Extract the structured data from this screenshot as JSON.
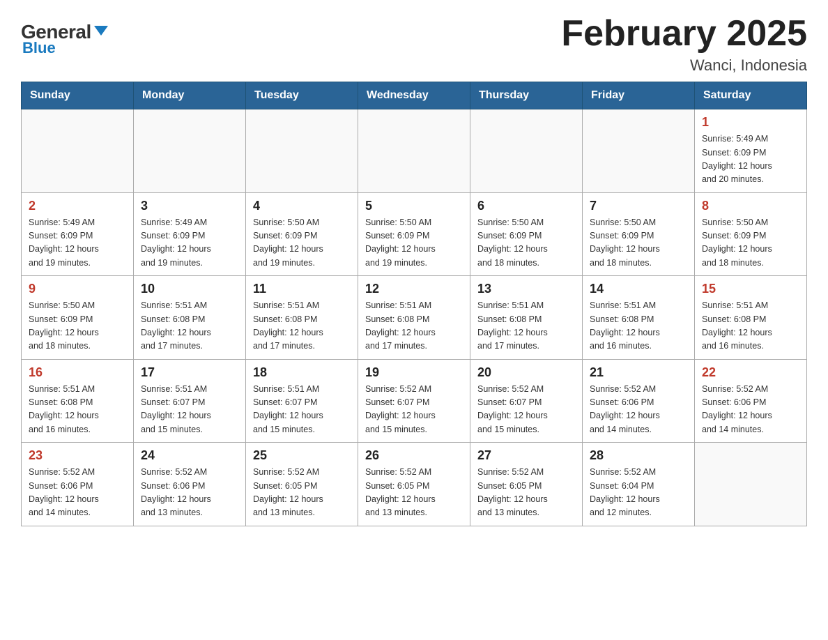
{
  "logo": {
    "general": "General",
    "blue": "Blue",
    "tagline": "GeneralBlue"
  },
  "header": {
    "title": "February 2025",
    "subtitle": "Wanci, Indonesia"
  },
  "days_of_week": [
    "Sunday",
    "Monday",
    "Tuesday",
    "Wednesday",
    "Thursday",
    "Friday",
    "Saturday"
  ],
  "weeks": [
    {
      "days": [
        {
          "number": "",
          "info": ""
        },
        {
          "number": "",
          "info": ""
        },
        {
          "number": "",
          "info": ""
        },
        {
          "number": "",
          "info": ""
        },
        {
          "number": "",
          "info": ""
        },
        {
          "number": "",
          "info": ""
        },
        {
          "number": "1",
          "info": "Sunrise: 5:49 AM\nSunset: 6:09 PM\nDaylight: 12 hours\nand 20 minutes."
        }
      ]
    },
    {
      "days": [
        {
          "number": "2",
          "info": "Sunrise: 5:49 AM\nSunset: 6:09 PM\nDaylight: 12 hours\nand 19 minutes."
        },
        {
          "number": "3",
          "info": "Sunrise: 5:49 AM\nSunset: 6:09 PM\nDaylight: 12 hours\nand 19 minutes."
        },
        {
          "number": "4",
          "info": "Sunrise: 5:50 AM\nSunset: 6:09 PM\nDaylight: 12 hours\nand 19 minutes."
        },
        {
          "number": "5",
          "info": "Sunrise: 5:50 AM\nSunset: 6:09 PM\nDaylight: 12 hours\nand 19 minutes."
        },
        {
          "number": "6",
          "info": "Sunrise: 5:50 AM\nSunset: 6:09 PM\nDaylight: 12 hours\nand 18 minutes."
        },
        {
          "number": "7",
          "info": "Sunrise: 5:50 AM\nSunset: 6:09 PM\nDaylight: 12 hours\nand 18 minutes."
        },
        {
          "number": "8",
          "info": "Sunrise: 5:50 AM\nSunset: 6:09 PM\nDaylight: 12 hours\nand 18 minutes."
        }
      ]
    },
    {
      "days": [
        {
          "number": "9",
          "info": "Sunrise: 5:50 AM\nSunset: 6:09 PM\nDaylight: 12 hours\nand 18 minutes."
        },
        {
          "number": "10",
          "info": "Sunrise: 5:51 AM\nSunset: 6:08 PM\nDaylight: 12 hours\nand 17 minutes."
        },
        {
          "number": "11",
          "info": "Sunrise: 5:51 AM\nSunset: 6:08 PM\nDaylight: 12 hours\nand 17 minutes."
        },
        {
          "number": "12",
          "info": "Sunrise: 5:51 AM\nSunset: 6:08 PM\nDaylight: 12 hours\nand 17 minutes."
        },
        {
          "number": "13",
          "info": "Sunrise: 5:51 AM\nSunset: 6:08 PM\nDaylight: 12 hours\nand 17 minutes."
        },
        {
          "number": "14",
          "info": "Sunrise: 5:51 AM\nSunset: 6:08 PM\nDaylight: 12 hours\nand 16 minutes."
        },
        {
          "number": "15",
          "info": "Sunrise: 5:51 AM\nSunset: 6:08 PM\nDaylight: 12 hours\nand 16 minutes."
        }
      ]
    },
    {
      "days": [
        {
          "number": "16",
          "info": "Sunrise: 5:51 AM\nSunset: 6:08 PM\nDaylight: 12 hours\nand 16 minutes."
        },
        {
          "number": "17",
          "info": "Sunrise: 5:51 AM\nSunset: 6:07 PM\nDaylight: 12 hours\nand 15 minutes."
        },
        {
          "number": "18",
          "info": "Sunrise: 5:51 AM\nSunset: 6:07 PM\nDaylight: 12 hours\nand 15 minutes."
        },
        {
          "number": "19",
          "info": "Sunrise: 5:52 AM\nSunset: 6:07 PM\nDaylight: 12 hours\nand 15 minutes."
        },
        {
          "number": "20",
          "info": "Sunrise: 5:52 AM\nSunset: 6:07 PM\nDaylight: 12 hours\nand 15 minutes."
        },
        {
          "number": "21",
          "info": "Sunrise: 5:52 AM\nSunset: 6:06 PM\nDaylight: 12 hours\nand 14 minutes."
        },
        {
          "number": "22",
          "info": "Sunrise: 5:52 AM\nSunset: 6:06 PM\nDaylight: 12 hours\nand 14 minutes."
        }
      ]
    },
    {
      "days": [
        {
          "number": "23",
          "info": "Sunrise: 5:52 AM\nSunset: 6:06 PM\nDaylight: 12 hours\nand 14 minutes."
        },
        {
          "number": "24",
          "info": "Sunrise: 5:52 AM\nSunset: 6:06 PM\nDaylight: 12 hours\nand 13 minutes."
        },
        {
          "number": "25",
          "info": "Sunrise: 5:52 AM\nSunset: 6:05 PM\nDaylight: 12 hours\nand 13 minutes."
        },
        {
          "number": "26",
          "info": "Sunrise: 5:52 AM\nSunset: 6:05 PM\nDaylight: 12 hours\nand 13 minutes."
        },
        {
          "number": "27",
          "info": "Sunrise: 5:52 AM\nSunset: 6:05 PM\nDaylight: 12 hours\nand 13 minutes."
        },
        {
          "number": "28",
          "info": "Sunrise: 5:52 AM\nSunset: 6:04 PM\nDaylight: 12 hours\nand 12 minutes."
        },
        {
          "number": "",
          "info": ""
        }
      ]
    }
  ]
}
